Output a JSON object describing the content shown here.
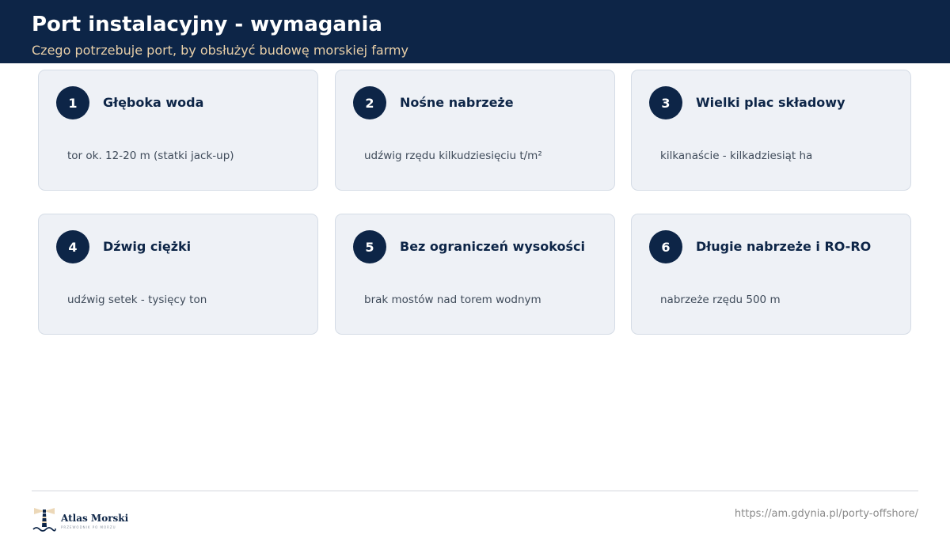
{
  "header": {
    "title": "Port instalacyjny - wymagania",
    "subtitle": "Czego potrzebuje port, by obsłużyć budowę morskiej farmy"
  },
  "cards": [
    {
      "number": "1",
      "title": "Głęboka woda",
      "desc": "tor ok. 12-20 m (statki jack-up)"
    },
    {
      "number": "2",
      "title": "Nośne nabrzeże",
      "desc": "udźwig rzędu kilkudziesięciu t/m²"
    },
    {
      "number": "3",
      "title": "Wielki plac składowy",
      "desc": "kilkanaście - kilkadziesiąt ha"
    },
    {
      "number": "4",
      "title": "Dźwig ciężki",
      "desc": "udźwig setek - tysięcy ton"
    },
    {
      "number": "5",
      "title": "Bez ograniczeń wysokości",
      "desc": "brak mostów nad torem wodnym"
    },
    {
      "number": "6",
      "title": "Długie nabrzeże i RO-RO",
      "desc": "nabrzeże rzędu 500 m"
    }
  ],
  "footer": {
    "logo_name": "Atlas Morski",
    "logo_tagline": "PRZEWODNIK PO MORZU",
    "url": "https://am.gdynia.pl/porty-offshore/"
  },
  "colors": {
    "header_bg": "#0d2547",
    "subtitle": "#e8cfa8",
    "card_bg": "#eef1f6",
    "badge_bg": "#0d2547"
  }
}
